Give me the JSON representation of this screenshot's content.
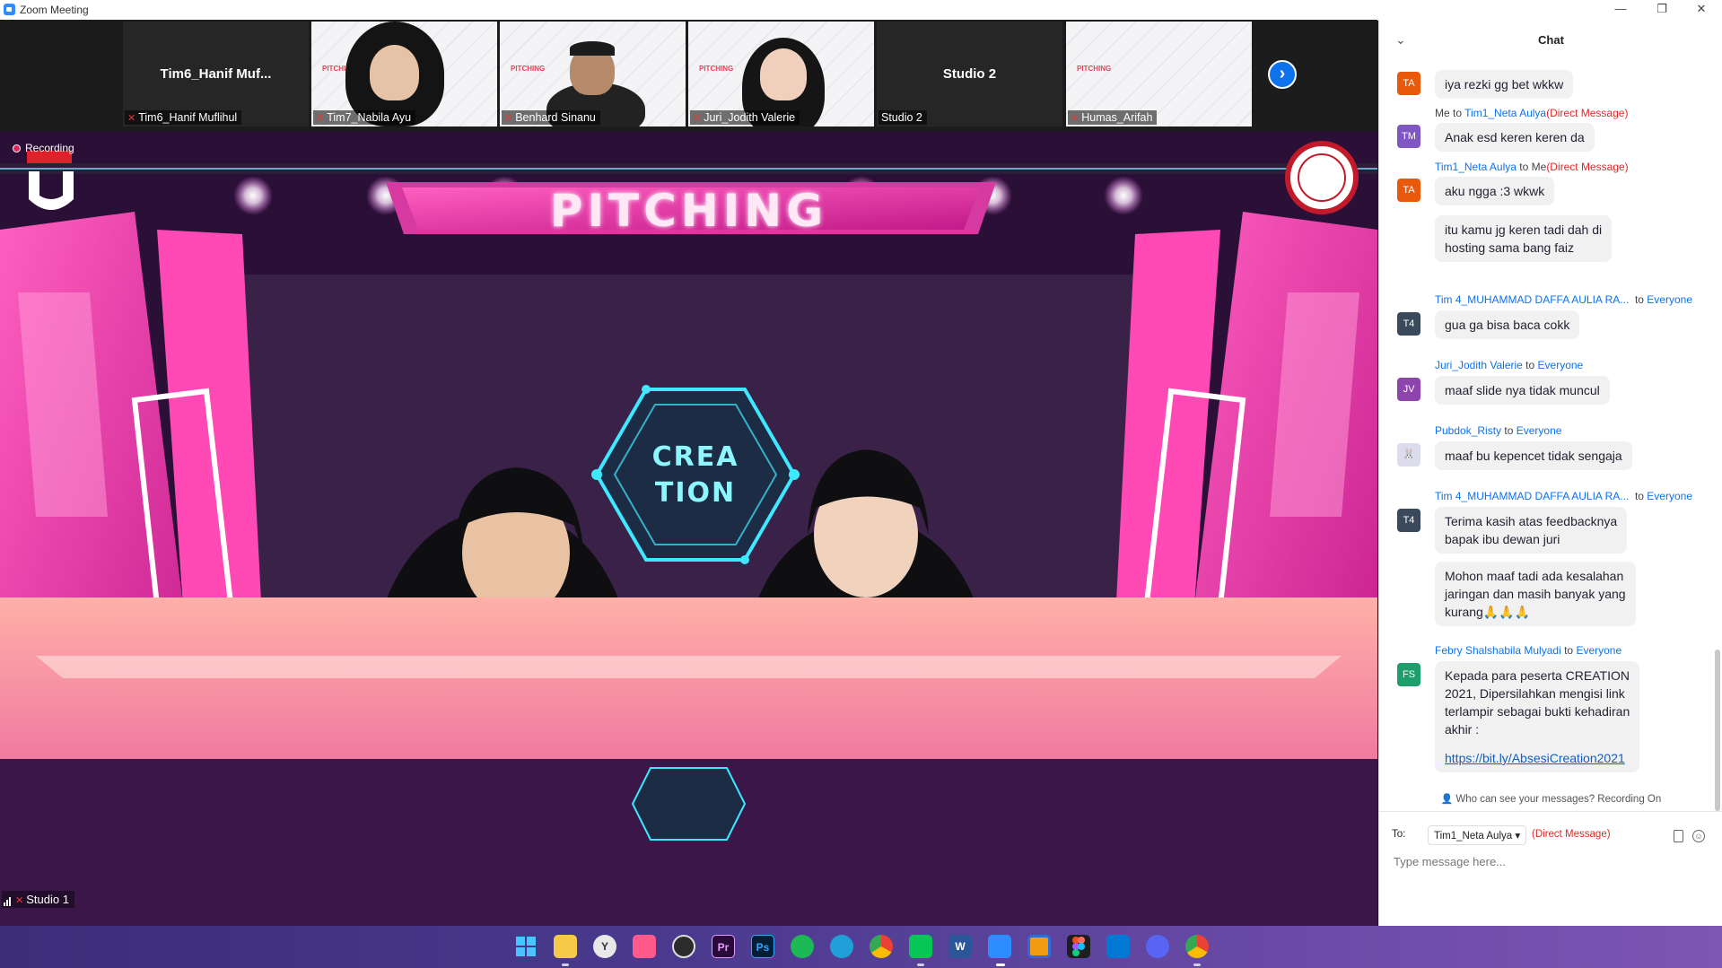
{
  "window": {
    "title": "Zoom Meeting"
  },
  "thumbnails": [
    {
      "name": "Tim6_Hanif Muflihul",
      "center_label": "Tim6_Hanif  Muf...",
      "muted": true,
      "kind": "name"
    },
    {
      "name": "Tim7_Nabila Ayu",
      "muted": true,
      "kind": "video"
    },
    {
      "name": "Benhard Sinanu",
      "muted": true,
      "kind": "video"
    },
    {
      "name": "Juri_Jodith Valerie",
      "muted": true,
      "kind": "video"
    },
    {
      "name": "Studio 2",
      "center_label": "Studio 2",
      "muted": false,
      "kind": "name"
    },
    {
      "name": "Humas_Arifah",
      "muted": true,
      "kind": "slide"
    }
  ],
  "stage": {
    "recording_label": "Recording",
    "banner_text": "PITCHING",
    "logo_text_1": "CREA",
    "logo_text_2": "TION",
    "speaker_name": "Studio 1"
  },
  "chat": {
    "title": "Chat",
    "messages": [
      {
        "avatar": "TA",
        "avatar_color": "#e8590c",
        "text": "iya rezki gg bet wkkw"
      },
      {
        "from": "Me",
        "to_word": "to",
        "to": "Tim1_Neta Aulya",
        "tag": "(Direct Message)",
        "avatar": "TM",
        "avatar_color": "#7e57c2",
        "text": "Anak esd keren keren da"
      },
      {
        "from": "Tim1_Neta Aulya",
        "to_word": "to",
        "to": "Me",
        "tag": "(Direct Message)",
        "avatar": "TA",
        "avatar_color": "#e8590c",
        "text": "aku ngga :3 wkwk"
      },
      {
        "text_lines": [
          "itu kamu jg keren tadi dah di",
          "hosting sama bang faiz"
        ]
      },
      {
        "from": "Tim 4_MUHAMMAD DAFFA AULIA RA...",
        "to_word": "to",
        "to": "Everyone",
        "avatar": "T4",
        "avatar_color": "#3a4a5c",
        "text": "gua ga bisa baca cokk"
      },
      {
        "from": "Juri_Jodith Valerie",
        "to_word": "to",
        "to": "Everyone",
        "avatar": "JV",
        "avatar_color": "#8e44ad",
        "text": "maaf slide nya tidak muncul"
      },
      {
        "from": "Pubdok_Risty",
        "to_word": "to",
        "to": "Everyone",
        "avatar": "bunny",
        "avatar_color": "#d8d8e8",
        "text": "maaf bu kepencet tidak sengaja"
      },
      {
        "from": "Tim 4_MUHAMMAD DAFFA AULIA RA...",
        "to_word": "to",
        "to": "Everyone",
        "avatar": "T4",
        "avatar_color": "#3a4a5c",
        "text_lines": [
          "Terima kasih atas feedbacknya",
          "bapak ibu dewan juri"
        ]
      },
      {
        "text_lines": [
          "Mohon maaf tadi ada kesalahan",
          "jaringan dan masih banyak yang",
          "kurang🙏🙏🙏"
        ]
      },
      {
        "from": "Febry Shalshabila Mulyadi",
        "to_word": "to",
        "to": "Everyone",
        "avatar": "FS",
        "avatar_color": "#1e9e6a",
        "text_lines": [
          "Kepada para peserta CREATION",
          "2021, Dipersilahkan mengisi link",
          "terlampir sebagai bukti kehadiran",
          "akhir :"
        ],
        "link": "https://bit.ly/AbsesiCreation2021"
      }
    ],
    "privacy_text": "Who can see your messages? Recording On",
    "to_label": "To:",
    "to_value": "Tim1_Neta Aulya",
    "to_tag": "(Direct Message)",
    "input_placeholder": "Type message here..."
  },
  "taskbar": {
    "icons": [
      "windows-start",
      "file-explorer",
      "app-y",
      "app-pink",
      "obs",
      "premiere-pro",
      "photoshop",
      "spotify",
      "edge",
      "chrome",
      "line",
      "word",
      "zoom",
      "virtualbox",
      "figma",
      "vscode",
      "discord",
      "chrome-profile"
    ],
    "labels": {
      "premiere": "Pr",
      "photoshop": "Ps",
      "word": "W"
    }
  }
}
